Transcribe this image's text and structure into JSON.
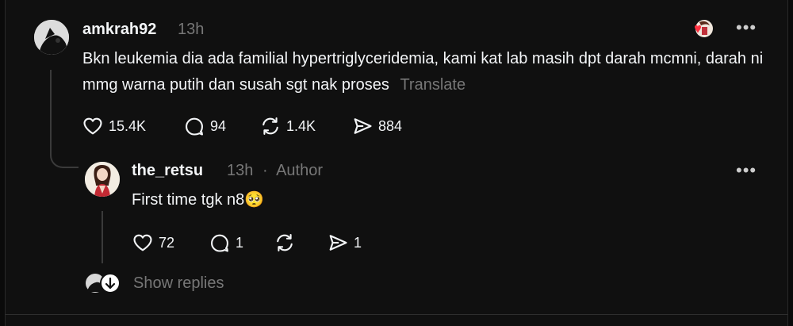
{
  "post": {
    "username": "amkrah92",
    "time": "13h",
    "text": "Bkn leukemia dia ada familial hypertriglyceridemia, kami kat lab masih dpt darah mcmni, darah ni mmg warna putih dan susah sgt nak proses",
    "translate": "Translate",
    "likes": "15.4K",
    "replies": "94",
    "reposts": "1.4K",
    "shares": "884"
  },
  "reply": {
    "username": "the_retsu",
    "time": "13h",
    "separator": "·",
    "badge": "Author",
    "text": "First time tgk n8🥺",
    "likes": "72",
    "replies": "1",
    "shares": "1"
  },
  "footer": {
    "show_replies": "Show replies"
  },
  "icons": [
    "heart-icon",
    "comment-icon",
    "repost-icon",
    "share-icon",
    "more-icon"
  ],
  "colors": {
    "background": "#101010",
    "text": "#f3f5f7",
    "muted": "#777777",
    "accent_red": "#ff3040"
  }
}
